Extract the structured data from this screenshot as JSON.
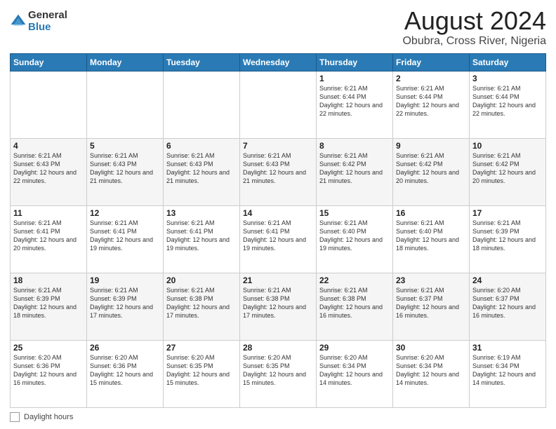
{
  "logo": {
    "general": "General",
    "blue": "Blue"
  },
  "title": "August 2024",
  "subtitle": "Obubra, Cross River, Nigeria",
  "weekdays": [
    "Sunday",
    "Monday",
    "Tuesday",
    "Wednesday",
    "Thursday",
    "Friday",
    "Saturday"
  ],
  "footer_label": "Daylight hours",
  "weeks": [
    [
      {
        "day": "",
        "info": ""
      },
      {
        "day": "",
        "info": ""
      },
      {
        "day": "",
        "info": ""
      },
      {
        "day": "",
        "info": ""
      },
      {
        "day": "1",
        "info": "Sunrise: 6:21 AM\nSunset: 6:44 PM\nDaylight: 12 hours\nand 22 minutes."
      },
      {
        "day": "2",
        "info": "Sunrise: 6:21 AM\nSunset: 6:44 PM\nDaylight: 12 hours\nand 22 minutes."
      },
      {
        "day": "3",
        "info": "Sunrise: 6:21 AM\nSunset: 6:44 PM\nDaylight: 12 hours\nand 22 minutes."
      }
    ],
    [
      {
        "day": "4",
        "info": "Sunrise: 6:21 AM\nSunset: 6:43 PM\nDaylight: 12 hours\nand 22 minutes."
      },
      {
        "day": "5",
        "info": "Sunrise: 6:21 AM\nSunset: 6:43 PM\nDaylight: 12 hours\nand 21 minutes."
      },
      {
        "day": "6",
        "info": "Sunrise: 6:21 AM\nSunset: 6:43 PM\nDaylight: 12 hours\nand 21 minutes."
      },
      {
        "day": "7",
        "info": "Sunrise: 6:21 AM\nSunset: 6:43 PM\nDaylight: 12 hours\nand 21 minutes."
      },
      {
        "day": "8",
        "info": "Sunrise: 6:21 AM\nSunset: 6:42 PM\nDaylight: 12 hours\nand 21 minutes."
      },
      {
        "day": "9",
        "info": "Sunrise: 6:21 AM\nSunset: 6:42 PM\nDaylight: 12 hours\nand 20 minutes."
      },
      {
        "day": "10",
        "info": "Sunrise: 6:21 AM\nSunset: 6:42 PM\nDaylight: 12 hours\nand 20 minutes."
      }
    ],
    [
      {
        "day": "11",
        "info": "Sunrise: 6:21 AM\nSunset: 6:41 PM\nDaylight: 12 hours\nand 20 minutes."
      },
      {
        "day": "12",
        "info": "Sunrise: 6:21 AM\nSunset: 6:41 PM\nDaylight: 12 hours\nand 19 minutes."
      },
      {
        "day": "13",
        "info": "Sunrise: 6:21 AM\nSunset: 6:41 PM\nDaylight: 12 hours\nand 19 minutes."
      },
      {
        "day": "14",
        "info": "Sunrise: 6:21 AM\nSunset: 6:41 PM\nDaylight: 12 hours\nand 19 minutes."
      },
      {
        "day": "15",
        "info": "Sunrise: 6:21 AM\nSunset: 6:40 PM\nDaylight: 12 hours\nand 19 minutes."
      },
      {
        "day": "16",
        "info": "Sunrise: 6:21 AM\nSunset: 6:40 PM\nDaylight: 12 hours\nand 18 minutes."
      },
      {
        "day": "17",
        "info": "Sunrise: 6:21 AM\nSunset: 6:39 PM\nDaylight: 12 hours\nand 18 minutes."
      }
    ],
    [
      {
        "day": "18",
        "info": "Sunrise: 6:21 AM\nSunset: 6:39 PM\nDaylight: 12 hours\nand 18 minutes."
      },
      {
        "day": "19",
        "info": "Sunrise: 6:21 AM\nSunset: 6:39 PM\nDaylight: 12 hours\nand 17 minutes."
      },
      {
        "day": "20",
        "info": "Sunrise: 6:21 AM\nSunset: 6:38 PM\nDaylight: 12 hours\nand 17 minutes."
      },
      {
        "day": "21",
        "info": "Sunrise: 6:21 AM\nSunset: 6:38 PM\nDaylight: 12 hours\nand 17 minutes."
      },
      {
        "day": "22",
        "info": "Sunrise: 6:21 AM\nSunset: 6:38 PM\nDaylight: 12 hours\nand 16 minutes."
      },
      {
        "day": "23",
        "info": "Sunrise: 6:21 AM\nSunset: 6:37 PM\nDaylight: 12 hours\nand 16 minutes."
      },
      {
        "day": "24",
        "info": "Sunrise: 6:20 AM\nSunset: 6:37 PM\nDaylight: 12 hours\nand 16 minutes."
      }
    ],
    [
      {
        "day": "25",
        "info": "Sunrise: 6:20 AM\nSunset: 6:36 PM\nDaylight: 12 hours\nand 16 minutes."
      },
      {
        "day": "26",
        "info": "Sunrise: 6:20 AM\nSunset: 6:36 PM\nDaylight: 12 hours\nand 15 minutes."
      },
      {
        "day": "27",
        "info": "Sunrise: 6:20 AM\nSunset: 6:35 PM\nDaylight: 12 hours\nand 15 minutes."
      },
      {
        "day": "28",
        "info": "Sunrise: 6:20 AM\nSunset: 6:35 PM\nDaylight: 12 hours\nand 15 minutes."
      },
      {
        "day": "29",
        "info": "Sunrise: 6:20 AM\nSunset: 6:34 PM\nDaylight: 12 hours\nand 14 minutes."
      },
      {
        "day": "30",
        "info": "Sunrise: 6:20 AM\nSunset: 6:34 PM\nDaylight: 12 hours\nand 14 minutes."
      },
      {
        "day": "31",
        "info": "Sunrise: 6:19 AM\nSunset: 6:34 PM\nDaylight: 12 hours\nand 14 minutes."
      }
    ]
  ]
}
